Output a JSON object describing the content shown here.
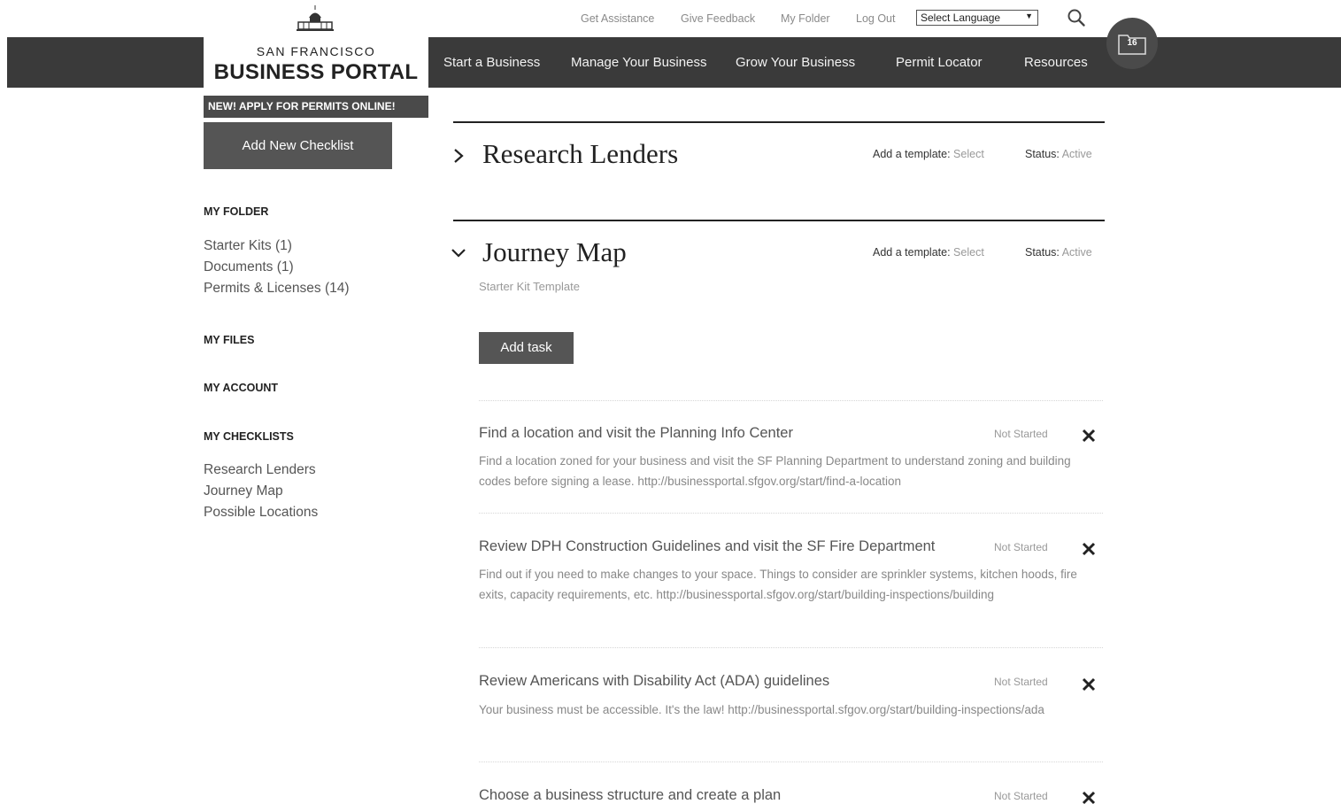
{
  "header": {
    "top_links": [
      {
        "label": "Get Assistance"
      },
      {
        "label": "Give Feedback"
      },
      {
        "label": "My Folder"
      },
      {
        "label": "Log Out"
      }
    ],
    "language_select": "Select Language",
    "logo": {
      "line1": "SAN FRANCISCO",
      "line2": "BUSINESS PORTAL"
    },
    "nav": [
      {
        "label": "Start a Business"
      },
      {
        "label": "Manage Your Business"
      },
      {
        "label": "Grow Your Business"
      },
      {
        "label": "Permit Locator"
      },
      {
        "label": "Resources"
      }
    ],
    "folder_count": "16"
  },
  "sidebar": {
    "banner": "NEW! APPLY FOR PERMITS ONLINE!",
    "add_checklist": "Add New Checklist",
    "my_folder": {
      "heading": "MY FOLDER",
      "items": [
        "Starter Kits (1)",
        "Documents (1)",
        "Permits & Licenses (14)"
      ]
    },
    "my_files": "MY FILES",
    "my_account": "MY ACCOUNT",
    "my_checklists": {
      "heading": "MY CHECKLISTS",
      "items": [
        "Research Lenders",
        "Journey Map",
        "Possible Locations"
      ]
    }
  },
  "main": {
    "template_label": "Add a template:",
    "template_value": "Select",
    "status_label": "Status:",
    "status_value": "Active",
    "sections": [
      {
        "title": "Research Lenders"
      },
      {
        "title": "Journey Map",
        "subtitle": "Starter Kit Template",
        "add_task": "Add task"
      }
    ],
    "tasks": [
      {
        "title": "Find a location and visit the Planning Info Center",
        "status": "Not Started",
        "description": "Find a location zoned for your business and visit the SF Planning Department to understand zoning and building codes before signing a lease. http://businessportal.sfgov.org/start/find-a-location"
      },
      {
        "title": "Review DPH Construction Guidelines and visit the SF Fire Department",
        "status": "Not Started",
        "description": "Find out if you need to make changes to your space. Things to consider are sprinkler systems, kitchen hoods, fire exits, capacity requirements, etc. http://businessportal.sfgov.org/start/building-inspections/building"
      },
      {
        "title": "Review Americans with Disability Act (ADA) guidelines",
        "status": "Not Started",
        "description": "Your business must be accessible. It's the law! http://businessportal.sfgov.org/start/building-inspections/ada"
      },
      {
        "title": "Choose a business structure and create a plan",
        "status": "Not Started"
      }
    ]
  }
}
